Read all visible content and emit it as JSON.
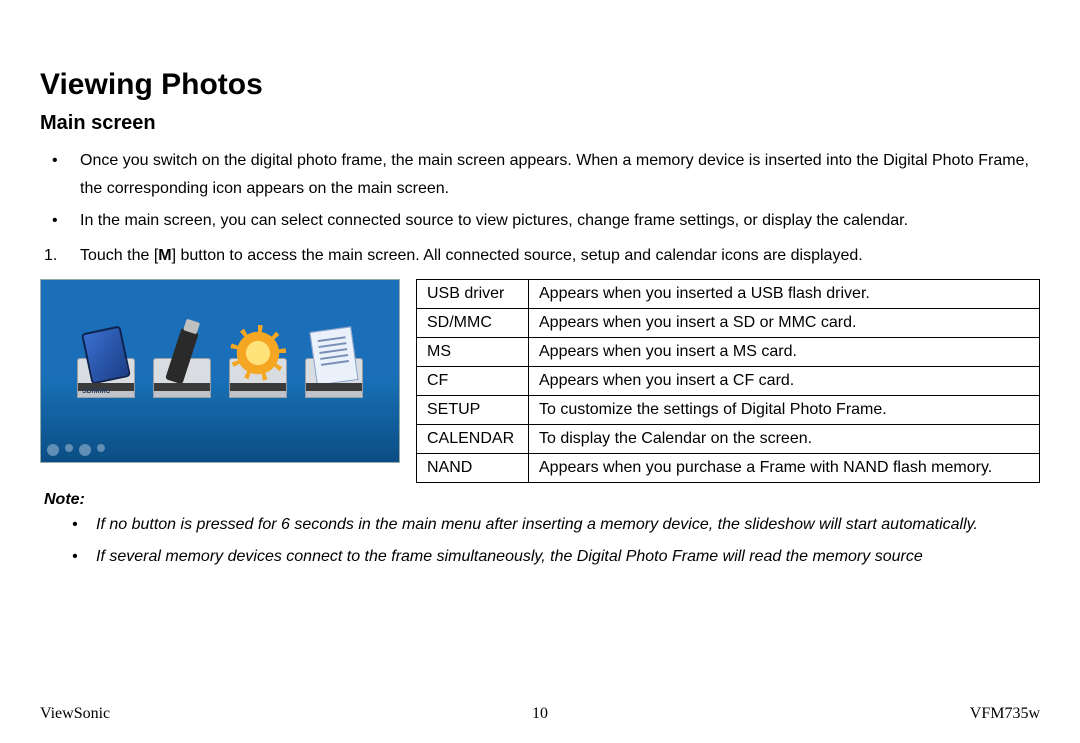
{
  "heading": "Viewing Photos",
  "subheading": "Main screen",
  "bullets": [
    "Once you switch on the digital photo frame, the main screen appears. When a memory device is inserted into the Digital Photo Frame, the corresponding icon appears on the main screen.",
    "In the main screen, you can select connected source to view pictures, change frame settings, or display the calendar."
  ],
  "step_number": "1.",
  "step_text_before": "Touch the [",
  "step_text_bold": "M",
  "step_text_after": "] button to access the main screen. All connected source, setup and calendar icons are displayed.",
  "table": [
    {
      "k": "USB driver",
      "v": "Appears when you inserted a USB flash driver."
    },
    {
      "k": "SD/MMC",
      "v": "Appears when you insert a SD or MMC card."
    },
    {
      "k": "MS",
      "v": "Appears when you insert a MS card."
    },
    {
      "k": "CF",
      "v": "Appears when you insert a CF card."
    },
    {
      "k": "SETUP",
      "v": "To customize the settings of Digital Photo Frame."
    },
    {
      "k": "CALENDAR",
      "v": "To display the Calendar on the screen."
    },
    {
      "k": "NAND",
      "v": "Appears when you purchase a Frame with NAND flash memory."
    }
  ],
  "note_label": "Note:",
  "notes": [
    "If no button is pressed for 6 seconds in the main menu after inserting a memory device, the slideshow will start automatically.",
    "If several memory devices connect to the frame simultaneously, the Digital Photo Frame will read the memory source"
  ],
  "footer": {
    "left": "ViewSonic",
    "center": "10",
    "right": "VFM735w"
  },
  "figure_label": "SD/MMC"
}
